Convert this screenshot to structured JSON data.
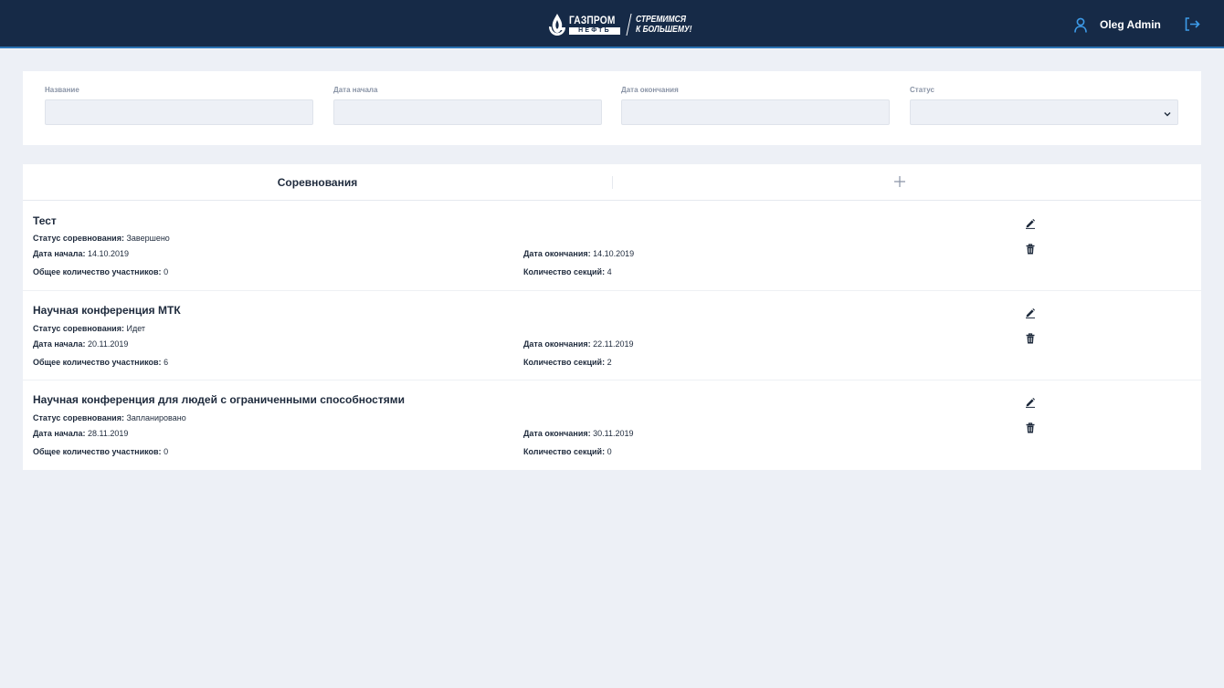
{
  "header": {
    "brand_name": "ГАЗПРОМ",
    "brand_sub": "НЕФТЬ",
    "slogan_line1": "СТРЕМИМСЯ",
    "slogan_line2": "К БОЛЬШЕМУ!",
    "user_name": "Oleg Admin",
    "accent_color": "#2b74b5",
    "background_color": "#162a47",
    "user_icon": "user-icon",
    "logout_icon": "logout-icon"
  },
  "filters": {
    "name_label": "Название",
    "name_value": "",
    "start_label": "Дата начала",
    "start_value": "",
    "end_label": "Дата окончания",
    "end_value": "",
    "status_label": "Статус",
    "status_value": ""
  },
  "list": {
    "title": "Соревнования",
    "add_icon": "plus-icon",
    "labels": {
      "status": "Статус соревнования:",
      "start": "Дата начала:",
      "end": "Дата окончания:",
      "participants": "Общее количество участников:",
      "sections": "Количество секций:"
    },
    "items": [
      {
        "title": "Тест",
        "status": "Завершено",
        "start": "14.10.2019",
        "end": "14.10.2019",
        "participants": "0",
        "sections": "4"
      },
      {
        "title": "Научная конференция МТК",
        "status": "Идет",
        "start": "20.11.2019",
        "end": "22.11.2019",
        "participants": "6",
        "sections": "2"
      },
      {
        "title": "Научная конференция для людей с ограниченными способностями",
        "status": "Запланировано",
        "start": "28.11.2019",
        "end": "30.11.2019",
        "participants": "0",
        "sections": "0"
      }
    ]
  }
}
